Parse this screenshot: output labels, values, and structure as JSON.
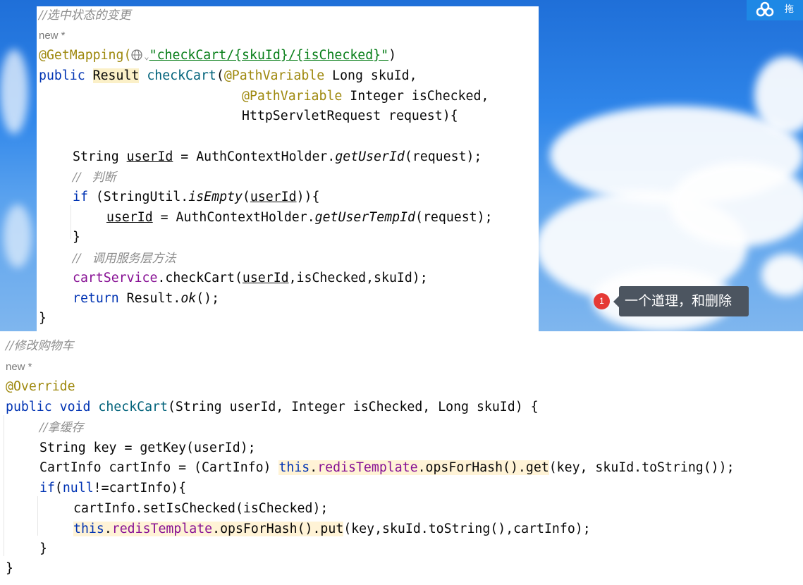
{
  "top_button": {
    "label": "拖",
    "icon": "baidu-netdisk-icon"
  },
  "notification": {
    "badge": "1",
    "text": "一个道理，和删除"
  },
  "controller": {
    "comment": "//选中状态的变更",
    "new_hint": "new *",
    "mapping_annotation": "@GetMapping(",
    "mapping_path": "\"checkCart/{skuId}/{isChecked}\"",
    "mapping_close": ")",
    "sig1_public": "public ",
    "sig1_type": "Result",
    "sig1_method": "checkCart",
    "sig1_paren": "(",
    "sig1_ann": "@PathVariable",
    "sig1_rest": " Long skuId,",
    "sig2_ann": "@PathVariable",
    "sig2_rest": " Integer isChecked,",
    "sig3": "HttpServletRequest request){",
    "l1_type": "String ",
    "l1_var": "userId",
    "l1_mid": " = AuthContextHolder.",
    "l1_call": "getUserId",
    "l1_end": "(request);",
    "c1": "//   判断",
    "if_kw": "if",
    "if_mid": " (StringUtil.",
    "if_call": "isEmpty",
    "if_open": "(",
    "if_var": "userId",
    "if_end": ")){",
    "l2_var": "userId",
    "l2_mid": " = AuthContextHolder.",
    "l2_call": "getUserTempId",
    "l2_end": "(request);",
    "close_brace": "}",
    "c2": "//   调用服务层方法",
    "l3_field": "cartService",
    "l3_mid": ".checkCart(",
    "l3_var": "userId",
    "l3_end": ",isChecked,skuId);",
    "ret_kw": "return",
    "ret_mid": " Result.",
    "ret_call": "ok",
    "ret_end": "();",
    "end_brace": "}"
  },
  "service": {
    "comment": "//修改购物车",
    "new_hint": "new *",
    "override": "@Override",
    "sig_kw": "public void ",
    "sig_method": "checkCart",
    "sig_rest": "(String userId, Integer isChecked, Long skuId) {",
    "c1": "//拿缓存",
    "l1": "String key = getKey(userId);",
    "l2_pre": "CartInfo cartInfo = (CartInfo) ",
    "l2_this": "this",
    "l2_dot": ".",
    "l2_field": "redisTemplate",
    "l2_call": ".opsForHash().get",
    "l2_end": "(key, skuId.toString());",
    "if_kw": "if",
    "if_open": "(",
    "if_null": "null",
    "if_end": "!=cartInfo){",
    "l3": "cartInfo.setIsChecked(isChecked);",
    "l4_this": "this",
    "l4_dot": ".",
    "l4_field": "redisTemplate",
    "l4_call": ".opsForHash().put",
    "l4_end": "(key,skuId.toString(),cartInfo);",
    "close_if": "}",
    "close_method": "}"
  }
}
